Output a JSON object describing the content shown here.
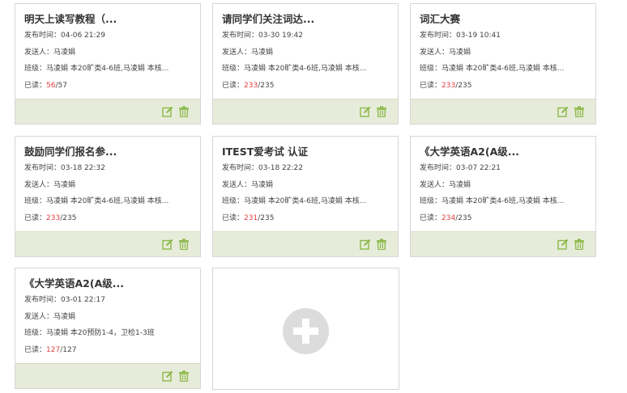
{
  "labels": {
    "publish_time": "发布时间：",
    "sender": "发送人：",
    "class": "班级：",
    "read": "已读："
  },
  "cards": [
    {
      "title": "明天上读写教程（...",
      "time": "04-06 21:29",
      "sender": "马凌娟",
      "classes": "马凌娟 本20旷类4-6班,马凌娟 本核...",
      "read": "56",
      "total": "/57"
    },
    {
      "title": "请同学们关注词达...",
      "time": "03-30 19:42",
      "sender": "马凌娟",
      "classes": "马凌娟 本20旷类4-6班,马凌娟 本核...",
      "read": "233",
      "total": "/235"
    },
    {
      "title": "词汇大赛",
      "time": "03-19 10:41",
      "sender": "马凌娟",
      "classes": "马凌娟 本20旷类4-6班,马凌娟 本核...",
      "read": "233",
      "total": "/235"
    },
    {
      "title": "鼓励同学们报名参...",
      "time": "03-18 22:32",
      "sender": "马凌娟",
      "classes": "马凌娟 本20旷类4-6班,马凌娟 本核...",
      "read": "233",
      "total": "/235"
    },
    {
      "title": "ITEST爱考试 认证",
      "time": "03-18 22:22",
      "sender": "马凌娟",
      "classes": "马凌娟 本20旷类4-6班,马凌娟 本核...",
      "read": "231",
      "total": "/235"
    },
    {
      "title": "《大学英语A2(A级...",
      "time": "03-07 22:21",
      "sender": "马凌娟",
      "classes": "马凌娟 本20旷类4-6班,马凌娟 本核...",
      "read": "234",
      "total": "/235"
    },
    {
      "title": "《大学英语A2(A级...",
      "time": "03-01 22:17",
      "sender": "马凌娟",
      "classes": "马凌娟 本20预防1-4，卫检1-3班",
      "read": "127",
      "total": "/127"
    }
  ],
  "colors": {
    "footer": "#e6ecd9",
    "icon": "#8cb84a",
    "read_highlight": "#e04040",
    "add_circle": "#dcdcdc"
  },
  "icons": {
    "edit": "edit-icon",
    "delete": "trash-icon",
    "add": "plus-icon"
  }
}
